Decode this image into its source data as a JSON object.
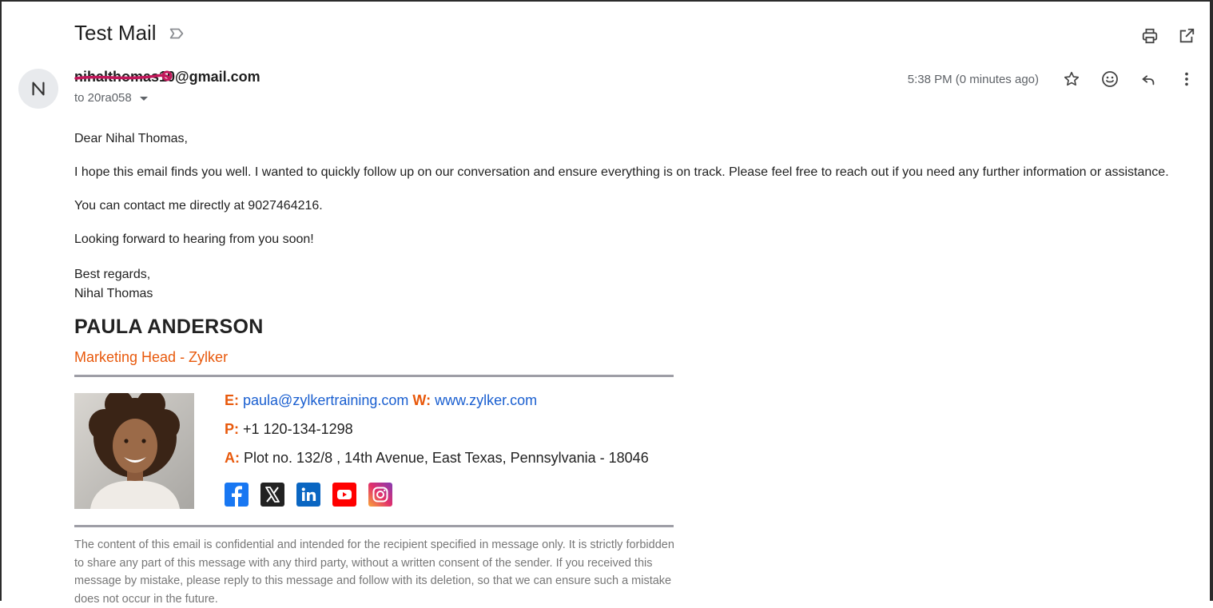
{
  "email": {
    "subject": "Test Mail",
    "sender": "nihalthomas10@gmail.com",
    "recipient": "to 20ra058",
    "timestamp": "5:38 PM (0 minutes ago)"
  },
  "icons": {
    "label": "label-icon",
    "print": "print-icon",
    "open_new_window": "open-in-new-window-icon",
    "star": "star-icon",
    "emoji": "emoji-react-icon",
    "reply": "reply-icon",
    "more": "more-vertical-icon"
  },
  "body": {
    "greeting": "Dear Nihal Thomas,",
    "paragraph1": "I hope this email finds you well. I wanted to quickly follow up on our conversation and ensure everything is on track. Please feel free to reach out if you need any further information or assistance.",
    "paragraph2": "You can contact me directly at 9027464216.",
    "paragraph3": "Looking forward to hearing from you soon!",
    "closing": "Best regards,",
    "signoff_name": "Nihal Thomas"
  },
  "signature": {
    "name": "PAULA ANDERSON",
    "title": "Marketing Head - Zylker",
    "email_label": "E:",
    "email": "paula@zylkertraining.com",
    "web_label": "W:",
    "web": "www.zylker.com",
    "phone_label": "P:",
    "phone": "+1 120-134-1298",
    "address_label": "A:",
    "address": "Plot no. 132/8 , 14th Avenue, East Texas, Pennsylvania - 18046",
    "accent_color": "#e8590c",
    "link_color": "#1a5fd0",
    "socials": [
      "facebook-icon",
      "x-twitter-icon",
      "linkedin-icon",
      "youtube-icon",
      "instagram-icon"
    ],
    "disclaimer": "The content of this email is confidential and intended for the recipient specified in message only. It is strictly forbidden to share any part of this message with any third party, without a written consent of the sender. If you received this message by mistake, please reply to this message and follow with its deletion, so that we can ensure such a mistake does not occur in the future."
  }
}
